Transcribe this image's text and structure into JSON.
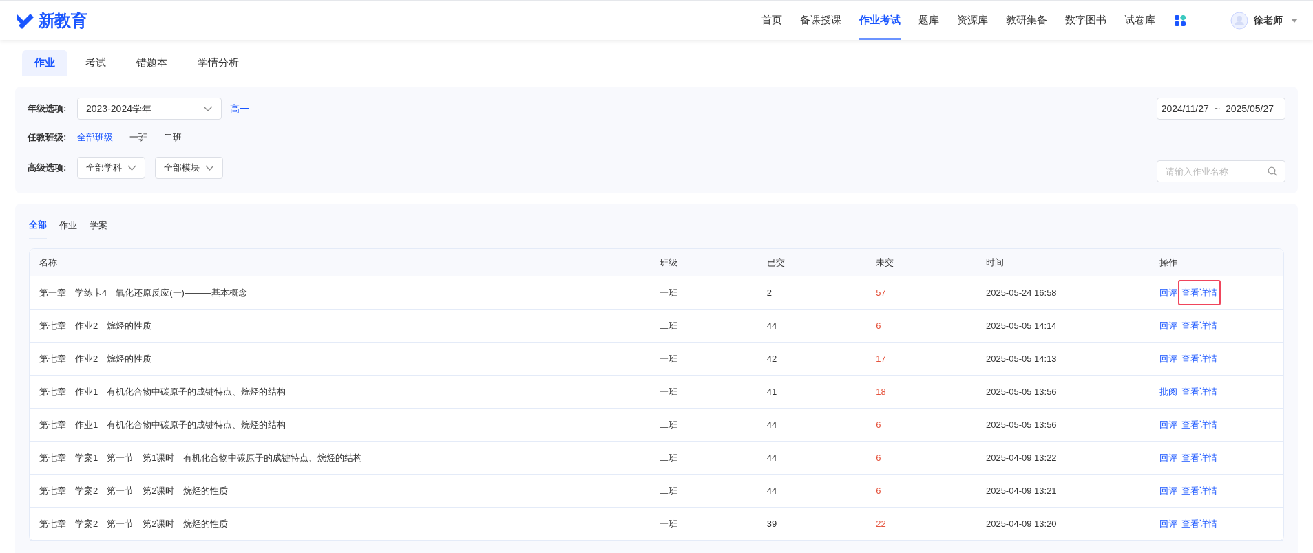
{
  "header": {
    "logo_text": "新教育",
    "nav": [
      {
        "label": "首页",
        "selected": false
      },
      {
        "label": "备课授课",
        "selected": false
      },
      {
        "label": "作业考试",
        "selected": true
      },
      {
        "label": "题库",
        "selected": false
      },
      {
        "label": "资源库",
        "selected": false
      },
      {
        "label": "教研集备",
        "selected": false
      },
      {
        "label": "数字图书",
        "selected": false
      },
      {
        "label": "试卷库",
        "selected": false
      }
    ],
    "user": "徐老师"
  },
  "tabs": [
    {
      "label": "作业",
      "selected": true
    },
    {
      "label": "考试",
      "selected": false
    },
    {
      "label": "错题本",
      "selected": false
    },
    {
      "label": "学情分析",
      "selected": false
    }
  ],
  "filters": {
    "grade": {
      "label": "年级选项:",
      "value": "2023-2024学年",
      "link": "高一"
    },
    "date_range": {
      "start": "2024/11/27",
      "separator": "~",
      "end": "2025/05/27"
    },
    "classes": {
      "label": "任教班级:",
      "options": [
        {
          "label": "全部班级",
          "selected": true
        },
        {
          "label": "一班",
          "selected": false
        },
        {
          "label": "二班",
          "selected": false
        }
      ]
    },
    "advanced": {
      "label": "高级选项:",
      "dropdowns": [
        "全部学科",
        "全部模块"
      ]
    },
    "search": {
      "placeholder": "请输入作业名称"
    }
  },
  "list_tabs": [
    {
      "label": "全部",
      "selected": true
    },
    {
      "label": "作业",
      "selected": false
    },
    {
      "label": "学案",
      "selected": false
    }
  ],
  "table": {
    "columns": [
      "名称",
      "班级",
      "已交",
      "未交",
      "时间",
      "操作"
    ],
    "rows": [
      {
        "name": "第一章　学练卡4　氧化还原反应(一)———基本概念",
        "class": "一班",
        "submitted": "2",
        "missing": "57",
        "time": "2025-05-24 16:58",
        "actions": [
          {
            "label": "回评",
            "highlighted": false
          },
          {
            "label": "查看详情",
            "highlighted": true
          }
        ]
      },
      {
        "name": "第七章　作业2　烷烃的性质",
        "class": "二班",
        "submitted": "44",
        "missing": "6",
        "time": "2025-05-05 14:14",
        "actions": [
          {
            "label": "回评",
            "highlighted": false
          },
          {
            "label": "查看详情",
            "highlighted": false
          }
        ]
      },
      {
        "name": "第七章　作业2　烷烃的性质",
        "class": "一班",
        "submitted": "42",
        "missing": "17",
        "time": "2025-05-05 14:13",
        "actions": [
          {
            "label": "回评",
            "highlighted": false
          },
          {
            "label": "查看详情",
            "highlighted": false
          }
        ]
      },
      {
        "name": "第七章　作业1　有机化合物中碳原子的成键特点、烷烃的结构",
        "class": "一班",
        "submitted": "41",
        "missing": "18",
        "time": "2025-05-05 13:56",
        "actions": [
          {
            "label": "批阅",
            "highlighted": false
          },
          {
            "label": "查看详情",
            "highlighted": false
          }
        ]
      },
      {
        "name": "第七章　作业1　有机化合物中碳原子的成键特点、烷烃的结构",
        "class": "二班",
        "submitted": "44",
        "missing": "6",
        "time": "2025-05-05 13:56",
        "actions": [
          {
            "label": "回评",
            "highlighted": false
          },
          {
            "label": "查看详情",
            "highlighted": false
          }
        ]
      },
      {
        "name": "第七章　学案1　第一节　第1课时　有机化合物中碳原子的成键特点、烷烃的结构",
        "class": "二班",
        "submitted": "44",
        "missing": "6",
        "time": "2025-04-09 13:22",
        "actions": [
          {
            "label": "回评",
            "highlighted": false
          },
          {
            "label": "查看详情",
            "highlighted": false
          }
        ]
      },
      {
        "name": "第七章　学案2　第一节　第2课时　烷烃的性质",
        "class": "二班",
        "submitted": "44",
        "missing": "6",
        "time": "2025-04-09 13:21",
        "actions": [
          {
            "label": "回评",
            "highlighted": false
          },
          {
            "label": "查看详情",
            "highlighted": false
          }
        ]
      },
      {
        "name": "第七章　学案2　第一节　第2课时　烷烃的性质",
        "class": "一班",
        "submitted": "39",
        "missing": "22",
        "time": "2025-04-09 13:20",
        "actions": [
          {
            "label": "回评",
            "highlighted": false
          },
          {
            "label": "查看详情",
            "highlighted": false
          }
        ]
      }
    ]
  }
}
